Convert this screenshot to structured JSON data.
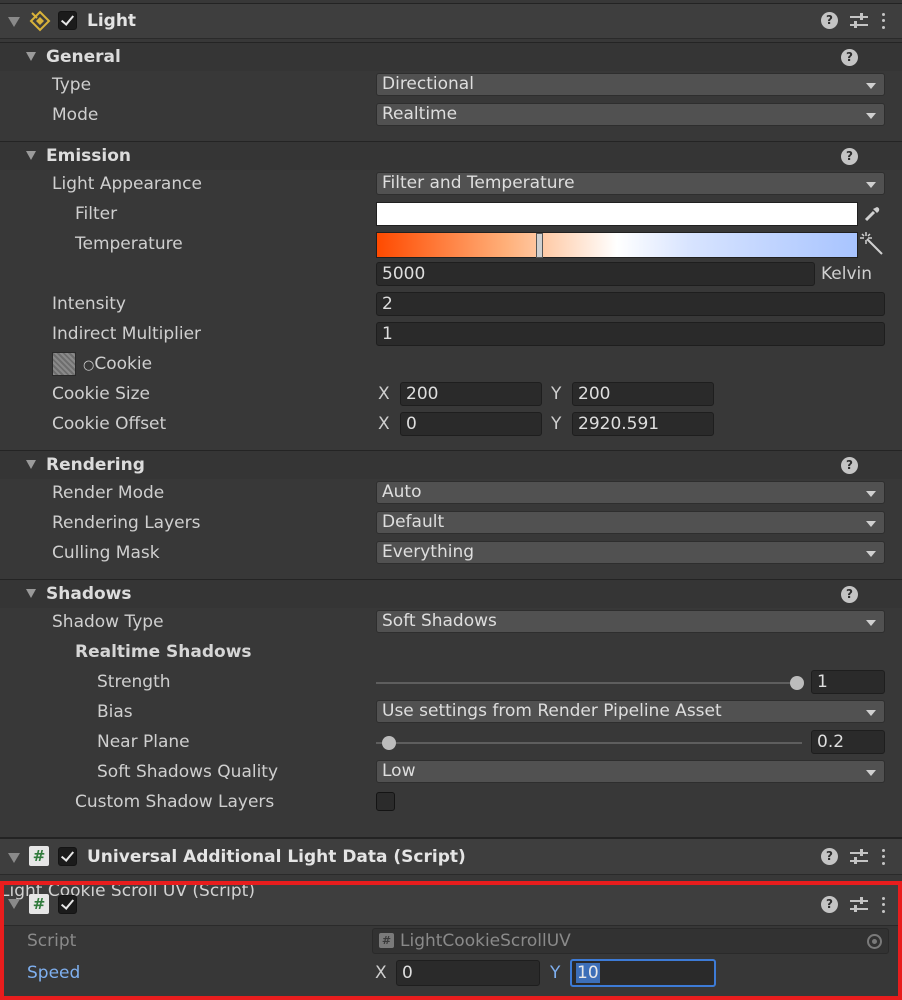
{
  "light": {
    "title": "Light",
    "general": {
      "title": "General",
      "type": {
        "label": "Type",
        "value": "Directional"
      },
      "mode": {
        "label": "Mode",
        "value": "Realtime"
      }
    },
    "emission": {
      "title": "Emission",
      "appearance": {
        "label": "Light Appearance",
        "value": "Filter and Temperature"
      },
      "filter": {
        "label": "Filter",
        "color": "#ffffff"
      },
      "temperature": {
        "label": "Temperature",
        "value": "5000",
        "unit": "Kelvin"
      },
      "intensity": {
        "label": "Intensity",
        "value": "2"
      },
      "indirect": {
        "label": "Indirect Multiplier",
        "value": "1"
      },
      "cookie": {
        "label": "Cookie",
        "glyph": "○"
      },
      "cookie_size": {
        "label": "Cookie Size",
        "x_label": "X",
        "x": "200",
        "y_label": "Y",
        "y": "200"
      },
      "cookie_offset": {
        "label": "Cookie Offset",
        "x_label": "X",
        "x": "0",
        "y_label": "Y",
        "y": "2920.591"
      }
    },
    "rendering": {
      "title": "Rendering",
      "render_mode": {
        "label": "Render Mode",
        "value": "Auto"
      },
      "layers": {
        "label": "Rendering Layers",
        "value": "Default"
      },
      "culling": {
        "label": "Culling Mask",
        "value": "Everything"
      }
    },
    "shadows": {
      "title": "Shadows",
      "type": {
        "label": "Shadow Type",
        "value": "Soft Shadows"
      },
      "realtime_title": "Realtime Shadows",
      "strength": {
        "label": "Strength",
        "value": "1",
        "fraction": 1.0
      },
      "bias": {
        "label": "Bias",
        "value": "Use settings from Render Pipeline Asset"
      },
      "near_plane": {
        "label": "Near Plane",
        "value": "0.2",
        "fraction": 0.0
      },
      "quality": {
        "label": "Soft Shadows Quality",
        "value": "Low"
      },
      "custom_layers": {
        "label": "Custom Shadow Layers",
        "checked": false
      }
    }
  },
  "additional": {
    "title": "Universal Additional Light Data (Script)"
  },
  "cookie_scroll": {
    "title": "Light Cookie Scroll UV (Script)",
    "script": {
      "label": "Script",
      "value": "LightCookieScrollUV"
    },
    "speed": {
      "label": "Speed",
      "x_label": "X",
      "x": "0",
      "y_label": "Y",
      "y": "10"
    }
  },
  "colors": {
    "highlight": "#e81d1d",
    "accent_label": "#7fb0f0",
    "selection": "#3d6fb8"
  },
  "icons": {
    "help": "?",
    "preset": "sliders-icon",
    "menu": "kebab-icon",
    "script": "#"
  }
}
